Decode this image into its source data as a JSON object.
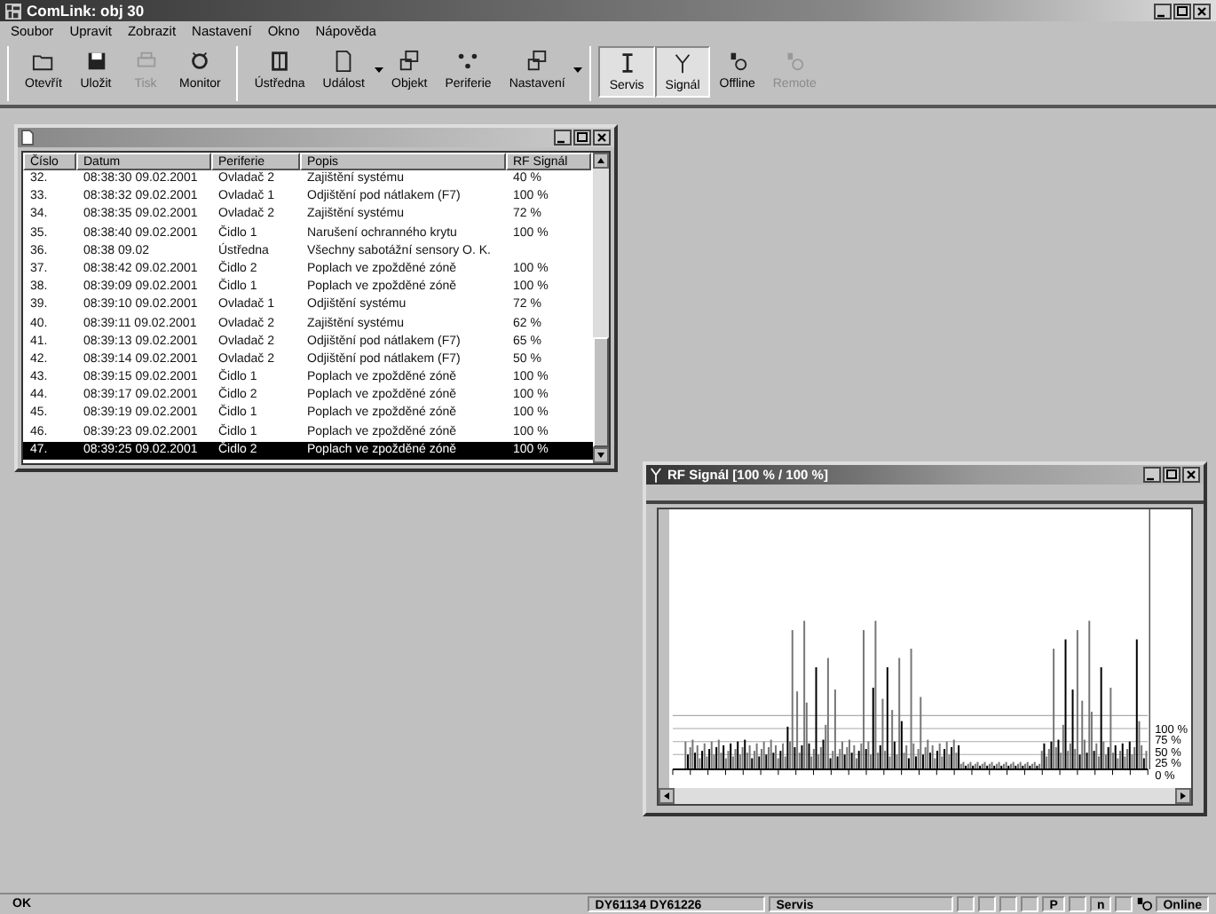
{
  "window": {
    "title": "ComLink: obj 30"
  },
  "menu": [
    "Soubor",
    "Upravit",
    "Zobrazit",
    "Nastavení",
    "Okno",
    "Nápověda"
  ],
  "toolbar": [
    {
      "label": "Otevřít",
      "disabled": false,
      "pressed": false,
      "dropdown": false
    },
    {
      "label": "Uložit",
      "disabled": false,
      "pressed": false,
      "dropdown": false
    },
    {
      "label": "Tisk",
      "disabled": true,
      "pressed": false,
      "dropdown": false
    },
    {
      "label": "Monitor",
      "disabled": false,
      "pressed": false,
      "dropdown": false
    },
    {
      "label": "Ústředna",
      "disabled": false,
      "pressed": false,
      "dropdown": false
    },
    {
      "label": "Událost",
      "disabled": false,
      "pressed": false,
      "dropdown": true
    },
    {
      "label": "Objekt",
      "disabled": false,
      "pressed": false,
      "dropdown": false
    },
    {
      "label": "Periferie",
      "disabled": false,
      "pressed": false,
      "dropdown": false
    },
    {
      "label": "Nastavení",
      "disabled": false,
      "pressed": false,
      "dropdown": true
    },
    {
      "label": "Servis",
      "disabled": false,
      "pressed": true,
      "dropdown": false
    },
    {
      "label": "Signál",
      "disabled": false,
      "pressed": true,
      "dropdown": false
    },
    {
      "label": "Offline",
      "disabled": false,
      "pressed": false,
      "dropdown": false
    },
    {
      "label": "Remote",
      "disabled": true,
      "pressed": false,
      "dropdown": false
    }
  ],
  "event_window": {
    "columns": [
      "Číslo",
      "Datum",
      "Periferie",
      "Popis",
      "RF Signál"
    ],
    "rows": [
      {
        "cells": [
          "32.",
          "08:38:30 09.02.2001",
          "Ovladač 2",
          "Zajištění systému",
          "40 %"
        ],
        "selected": false
      },
      {
        "cells": [
          "33.",
          "08:38:32 09.02.2001",
          "Ovladač 1",
          "Odjištění pod nátlakem (F7)",
          "100 %"
        ],
        "selected": false
      },
      {
        "cells": [
          "34.",
          "08:38:35 09.02.2001",
          "Ovladač 2",
          "Zajištění systému",
          "72 %"
        ],
        "selected": false
      },
      {
        "cells": [
          "35.",
          "08:38:40 09.02.2001",
          "Čidlo 1",
          "Narušení ochranného krytu",
          "100 %"
        ],
        "selected": false
      },
      {
        "cells": [
          "36.",
          "08:38 09.02",
          "Ústředna",
          "Všechny sabotážní sensory O. K.",
          ""
        ],
        "selected": false
      },
      {
        "cells": [
          "37.",
          "08:38:42 09.02.2001",
          "Čidlo 2",
          "Poplach ve zpožděné zóně",
          "100 %"
        ],
        "selected": false
      },
      {
        "cells": [
          "38.",
          "08:39:09 09.02.2001",
          "Čidlo 1",
          "Poplach ve zpožděné zóně",
          "100 %"
        ],
        "selected": false
      },
      {
        "cells": [
          "39.",
          "08:39:10 09.02.2001",
          "Ovladač 1",
          "Odjištění systému",
          "72 %"
        ],
        "selected": false
      },
      {
        "cells": [
          "40.",
          "08:39:11 09.02.2001",
          "Ovladač 2",
          "Zajištění systému",
          "62 %"
        ],
        "selected": false
      },
      {
        "cells": [
          "41.",
          "08:39:13 09.02.2001",
          "Ovladač 2",
          "Odjištění pod nátlakem (F7)",
          "65 %"
        ],
        "selected": false
      },
      {
        "cells": [
          "42.",
          "08:39:14 09.02.2001",
          "Ovladač 2",
          "Odjištění pod nátlakem (F7)",
          "50 %"
        ],
        "selected": false
      },
      {
        "cells": [
          "43.",
          "08:39:15 09.02.2001",
          "Čidlo 1",
          "Poplach ve zpožděné zóně",
          "100 %"
        ],
        "selected": false
      },
      {
        "cells": [
          "44.",
          "08:39:17 09.02.2001",
          "Čidlo 2",
          "Poplach ve zpožděné zóně",
          "100 %"
        ],
        "selected": false
      },
      {
        "cells": [
          "45.",
          "08:39:19 09.02.2001",
          "Čidlo 1",
          "Poplach ve zpožděné zóně",
          "100 %"
        ],
        "selected": false
      },
      {
        "cells": [
          "46.",
          "08:39:23 09.02.2001",
          "Čidlo 1",
          "Poplach ve zpožděné zóně",
          "100 %"
        ],
        "selected": false
      },
      {
        "cells": [
          "47.",
          "08:39:25 09.02.2001",
          "Čidlo 2",
          "Poplach ve zpožděné zóně",
          "100 %"
        ],
        "selected": true
      }
    ]
  },
  "signal_window": {
    "title": "RF Signál [100 % / 100 %]",
    "scale_labels": [
      "100 %",
      "75 %",
      "50 %",
      "25 %",
      "0 %"
    ]
  },
  "status_bar": {
    "message": "OK",
    "ids": "DY61134  DY61226",
    "mode": "Servis",
    "indicators": [
      "P",
      "n"
    ],
    "connection": "Online"
  }
}
